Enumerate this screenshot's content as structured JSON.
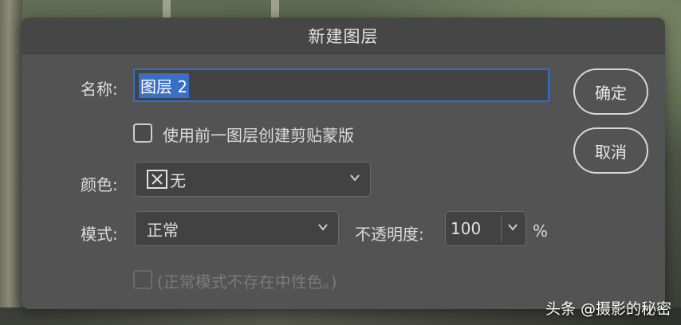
{
  "dialog": {
    "title": "新建图层",
    "name_label": "名称:",
    "name_value": "图层 2",
    "ok_label": "确定",
    "cancel_label": "取消",
    "clipping_mask_label": "使用前一图层创建剪贴蒙版",
    "color_label": "颜色:",
    "color_value": "无",
    "mode_label": "模式:",
    "mode_value": "正常",
    "opacity_label": "不透明度:",
    "opacity_value": "100",
    "opacity_unit": "%",
    "neutral_label": "(正常模式不存在中性色。)"
  },
  "watermark": {
    "text": "头条 @摄影的秘密"
  },
  "colors": {
    "dialog_bg": "#535353",
    "title_bg": "#464646",
    "focus_border": "#2c6ed5",
    "selection": "#3a6fc4"
  }
}
